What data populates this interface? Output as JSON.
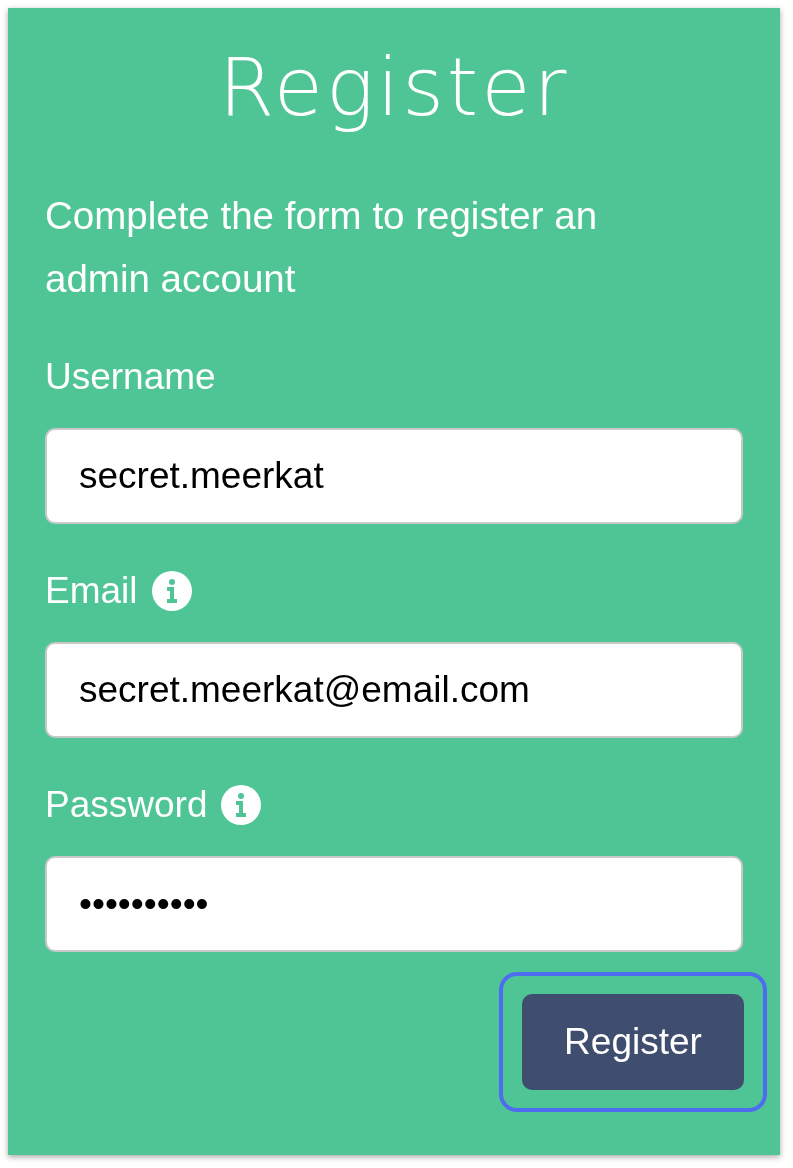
{
  "title": "Register",
  "description": "Complete the form to register an admin account",
  "fields": [
    {
      "label": "Username",
      "info": false,
      "value": "secret.meerkat"
    },
    {
      "label": "Email",
      "info": true,
      "value": "secret.meerkat@email.com"
    },
    {
      "label": "Password",
      "info": true,
      "value": "••••••••••"
    }
  ],
  "submit": {
    "label": "Register",
    "focused": true
  }
}
